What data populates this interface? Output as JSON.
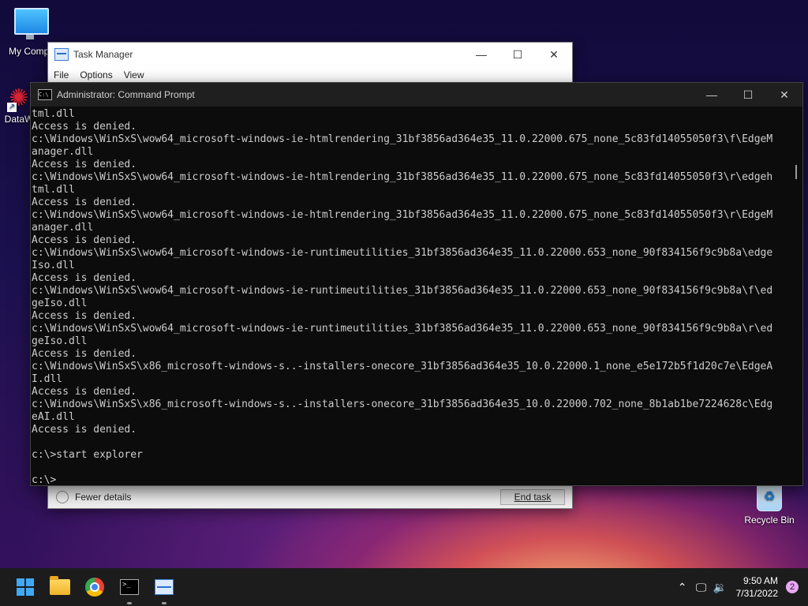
{
  "desktop": {
    "icons": [
      {
        "label": "My Compu"
      },
      {
        "label": "DataW"
      },
      {
        "label": "Recycle Bin"
      }
    ]
  },
  "task_manager": {
    "title": "Task Manager",
    "menu": [
      "File",
      "Options",
      "View"
    ],
    "fewer_details": "Fewer details",
    "end_task": "End task"
  },
  "cmd": {
    "title": "Administrator: Command Prompt",
    "lines": [
      "tml.dll",
      "Access is denied.",
      "c:\\Windows\\WinSxS\\wow64_microsoft-windows-ie-htmlrendering_31bf3856ad364e35_11.0.22000.675_none_5c83fd14055050f3\\f\\EdgeM",
      "anager.dll",
      "Access is denied.",
      "c:\\Windows\\WinSxS\\wow64_microsoft-windows-ie-htmlrendering_31bf3856ad364e35_11.0.22000.675_none_5c83fd14055050f3\\r\\edgeh",
      "tml.dll",
      "Access is denied.",
      "c:\\Windows\\WinSxS\\wow64_microsoft-windows-ie-htmlrendering_31bf3856ad364e35_11.0.22000.675_none_5c83fd14055050f3\\r\\EdgeM",
      "anager.dll",
      "Access is denied.",
      "c:\\Windows\\WinSxS\\wow64_microsoft-windows-ie-runtimeutilities_31bf3856ad364e35_11.0.22000.653_none_90f834156f9c9b8a\\edge",
      "Iso.dll",
      "Access is denied.",
      "c:\\Windows\\WinSxS\\wow64_microsoft-windows-ie-runtimeutilities_31bf3856ad364e35_11.0.22000.653_none_90f834156f9c9b8a\\f\\ed",
      "geIso.dll",
      "Access is denied.",
      "c:\\Windows\\WinSxS\\wow64_microsoft-windows-ie-runtimeutilities_31bf3856ad364e35_11.0.22000.653_none_90f834156f9c9b8a\\r\\ed",
      "geIso.dll",
      "Access is denied.",
      "c:\\Windows\\WinSxS\\x86_microsoft-windows-s..-installers-onecore_31bf3856ad364e35_10.0.22000.1_none_e5e172b5f1d20c7e\\EdgeA",
      "I.dll",
      "Access is denied.",
      "c:\\Windows\\WinSxS\\x86_microsoft-windows-s..-installers-onecore_31bf3856ad364e35_10.0.22000.702_none_8b1ab1be7224628c\\Edg",
      "eAI.dll",
      "Access is denied.",
      "",
      "c:\\>start explorer",
      "",
      "c:\\>"
    ]
  },
  "taskbar": {
    "time": "9:50 AM",
    "date": "7/31/2022",
    "notification_count": "2"
  }
}
